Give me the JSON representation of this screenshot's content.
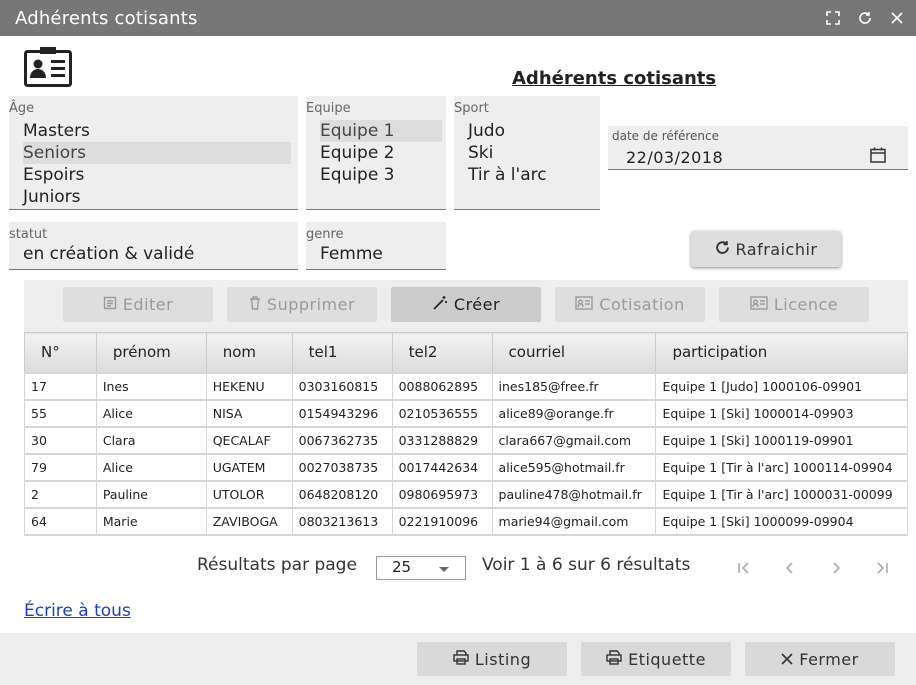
{
  "window": {
    "title": "Adhérents cotisants"
  },
  "heading": "Adhérents cotisants",
  "filters": {
    "age": {
      "label": "Âge",
      "options": [
        "Masters",
        "Seniors",
        "Espoirs",
        "Juniors"
      ],
      "selected": "Seniors"
    },
    "equipe": {
      "label": "Equipe",
      "options": [
        "Equipe 1",
        "Equipe 2",
        "Equipe 3"
      ],
      "selected": "Equipe 1"
    },
    "sport": {
      "label": "Sport",
      "options": [
        "Judo",
        "Ski",
        "Tir à l'arc"
      ]
    },
    "date": {
      "label": "date de référence",
      "value": "22/03/2018"
    },
    "statut": {
      "label": "statut",
      "value": "en création & validé"
    },
    "genre": {
      "label": "genre",
      "value": "Femme"
    }
  },
  "refresh_label": "Rafraichir",
  "toolbar": {
    "edit": "Editer",
    "delete": "Supprimer",
    "create": "Créer",
    "cotisation": "Cotisation",
    "licence": "Licence"
  },
  "table": {
    "headers": [
      "N°",
      "prénom",
      "nom",
      "tel1",
      "tel2",
      "courriel",
      "participation"
    ],
    "rows": [
      [
        "17",
        "Ines",
        "HEKENU",
        "0303160815",
        "0088062895",
        "ines185@free.fr",
        "Equipe 1 [Judo] 1000106-09901"
      ],
      [
        "55",
        "Alice",
        "NISA",
        "0154943296",
        "0210536555",
        "alice89@orange.fr",
        "Equipe 1 [Ski] 1000014-09903"
      ],
      [
        "30",
        "Clara",
        "QECALAF",
        "0067362735",
        "0331288829",
        "clara667@gmail.com",
        "Equipe 1 [Ski] 1000119-09901"
      ],
      [
        "79",
        "Alice",
        "UGATEM",
        "0027038735",
        "0017442634",
        "alice595@hotmail.fr",
        "Equipe 1 [Tir à l'arc] 1000114-09904"
      ],
      [
        "2",
        "Pauline",
        "UTOLOR",
        "0648208120",
        "0980695973",
        "pauline478@hotmail.fr",
        "Equipe 1 [Tir à l'arc] 1000031-00099"
      ],
      [
        "64",
        "Marie",
        "ZAVIBOGA",
        "0803213613",
        "0221910096",
        "marie94@gmail.com",
        "Equipe 1 [Ski] 1000099-09904"
      ]
    ]
  },
  "pagination": {
    "per_page_label": "Résultats par page",
    "per_page_value": "25",
    "summary": "Voir 1 à 6 sur 6 résultats"
  },
  "write_all": "Écrire à tous",
  "footer": {
    "listing": "Listing",
    "etiquette": "Etiquette",
    "close": "Fermer"
  },
  "icons": {
    "window": [
      "expand-icon",
      "refresh-icon",
      "close-icon"
    ],
    "logo": "id-card-icon"
  }
}
